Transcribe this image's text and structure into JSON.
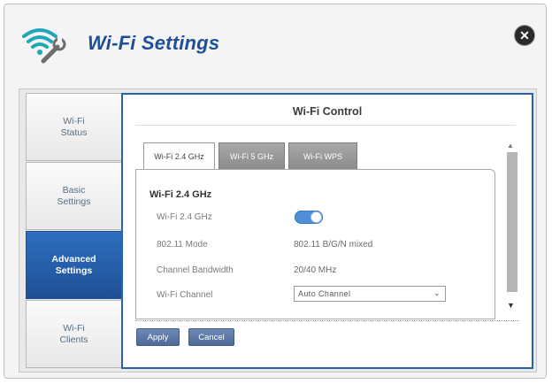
{
  "window": {
    "title": "Wi-Fi Settings",
    "close_label": "✕",
    "header_icon": "wifi-wrench-icon"
  },
  "nav": {
    "items": [
      {
        "label": "Wi-Fi Status",
        "line1": "Wi-Fi",
        "line2": "Status",
        "active": false
      },
      {
        "label": "Basic Settings",
        "line1": "Basic",
        "line2": "Settings",
        "active": false
      },
      {
        "label": "Advanced Settings",
        "line1": "Advanced",
        "line2": "Settings",
        "active": true
      },
      {
        "label": "Wi-Fi Clients",
        "line1": "Wi-Fi",
        "line2": "Clients",
        "active": false
      }
    ]
  },
  "panel": {
    "title": "Wi-Fi Control",
    "tabs": [
      {
        "label": "Wi-Fi 2.4 GHz",
        "active": true
      },
      {
        "label": "Wi-Fi 5 GHz",
        "active": false
      },
      {
        "label": "Wi-Fi WPS",
        "active": false
      }
    ],
    "section_title": "Wi-Fi 2.4 GHz",
    "rows": {
      "toggle_label": "Wi-Fi 2.4 GHz",
      "toggle_on": true,
      "mode_label": "802.11 Mode",
      "mode_value": "802.11 B/G/N mixed",
      "bandwidth_label": "Channel Bandwidth",
      "bandwidth_value": "20/40 MHz",
      "channel_label": "Wi-Fi Channel",
      "channel_value": "Auto Channel"
    },
    "buttons": {
      "apply": "Apply",
      "cancel": "Cancel"
    }
  },
  "colors": {
    "accent": "#1f4f95",
    "panel_border": "#2960b0",
    "toggle_on": "#4f8fd6",
    "button": "#5a77a5"
  }
}
